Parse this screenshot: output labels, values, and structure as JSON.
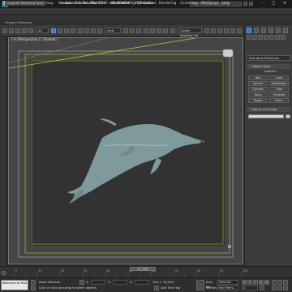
{
  "window": {
    "logo": "S",
    "title": "Autodesk 3ds Max 2017 x64    DOLPHIN_V01.max",
    "search_placeholder": "Type a keyword or phrase"
  },
  "menu": {
    "items": [
      "Edit",
      "Tools",
      "Group",
      "Views",
      "Create",
      "Modifiers",
      "Animation",
      "Graph Editors",
      "Rendering",
      "Customize",
      "MAXScript",
      "Help"
    ]
  },
  "ribbon": {
    "tabs": [
      "Graphite Modeling Tools",
      "Freeform",
      "Selection",
      "Object Paint",
      "Populate"
    ],
    "active_tab": 0,
    "subpanel": "Polygon Modeling"
  },
  "toolbar": {
    "selection_filter": "All",
    "view_dropdown": "View",
    "named_sets": "Create Selection Se"
  },
  "viewport": {
    "label": "[+] [Perspective ] [ Shaded ]"
  },
  "command_panel": {
    "category_dropdown": "Standard Primitives",
    "object_type_title": "Object Type",
    "autogrid_label": "AutoGrid",
    "buttons": [
      "Box",
      "Cone",
      "Sphere",
      "GeoSphere",
      "Cylinder",
      "Tube",
      "Torus",
      "Pyramid",
      "Teapot",
      "Plane"
    ],
    "name_color_title": "Name and Color"
  },
  "timeline": {
    "time_slider": "0 / 100",
    "ticks": [
      "0",
      "5",
      "10",
      "15",
      "20",
      "25",
      "30",
      "35",
      "40",
      "45",
      "50",
      "55",
      "60",
      "65",
      "70",
      "75",
      "80",
      "85",
      "90",
      "95",
      "100"
    ]
  },
  "status": {
    "listener_line1": "Welcome to MAX",
    "listener_line2": "",
    "selection_text": "None Selected",
    "prompt_text": "Click or click-and-drag to select objects",
    "x_label": "X:",
    "y_label": "Y:",
    "z_label": "Z:",
    "grid": "Grid = 10,0cm",
    "add_time_tag": "Add Time Tag",
    "auto_key": "Auto Key",
    "set_key": "Set Key",
    "selected_dropdown": "Selected",
    "key_filters": "Key Filters...",
    "frame": "0"
  },
  "colors": {
    "viewport_bg": "#454545",
    "dolphin": "#7e9a9c",
    "safe_frame_outer": "#7fa8a8",
    "safe_frame_inner": "#a8a83a",
    "accent_blue": "#3b78c8"
  }
}
